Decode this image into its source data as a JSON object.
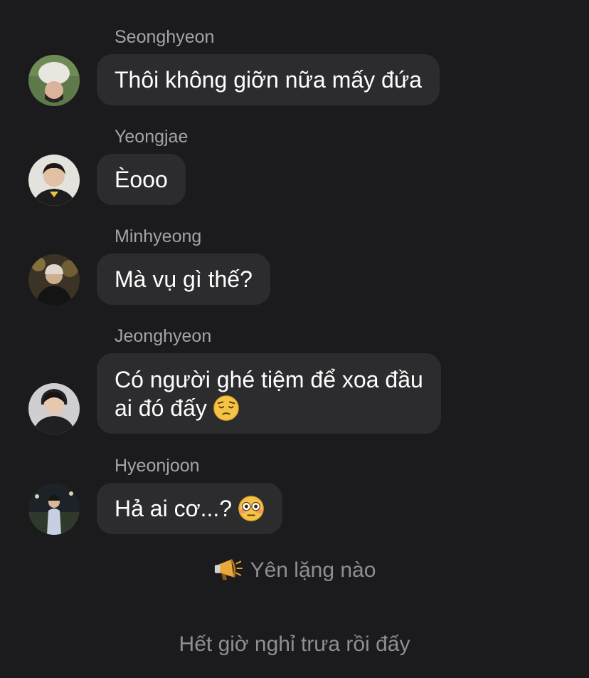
{
  "messages": [
    {
      "sender": "Seonghyeon",
      "text": "Thôi không giỡn nữa mấy đứa",
      "avatar_icon": "person-lying-on-grass-avatar"
    },
    {
      "sender": "Yeongjae",
      "text": "Èooo",
      "avatar_icon": "person-in-black-jacket-avatar"
    },
    {
      "sender": "Minhyeong",
      "text": "Mà vụ gì thế?",
      "avatar_icon": "person-in-cap-avatar"
    },
    {
      "sender": "Jeonghyeon",
      "text_line1": "Có người ghé tiệm để xoa đầu",
      "text_line2": "ai đó đấy",
      "emoji": "pensive-face-emoji",
      "avatar_icon": "person-with-headphones-avatar"
    },
    {
      "sender": "Hyeonjoon",
      "text": "Hả ai cơ...?",
      "emoji": "flushed-face-emoji",
      "avatar_icon": "person-standing-outdoors-avatar"
    }
  ],
  "system_messages": [
    {
      "text": "Yên lặng nào",
      "icon": "megaphone-icon"
    },
    {
      "text": "Hết giờ nghỉ trưa rồi đấy"
    }
  ],
  "colors": {
    "background": "#1b1b1d",
    "bubble": "#2c2c2f",
    "sender_text": "#a3a3aa",
    "system_text": "#8e8e95"
  }
}
